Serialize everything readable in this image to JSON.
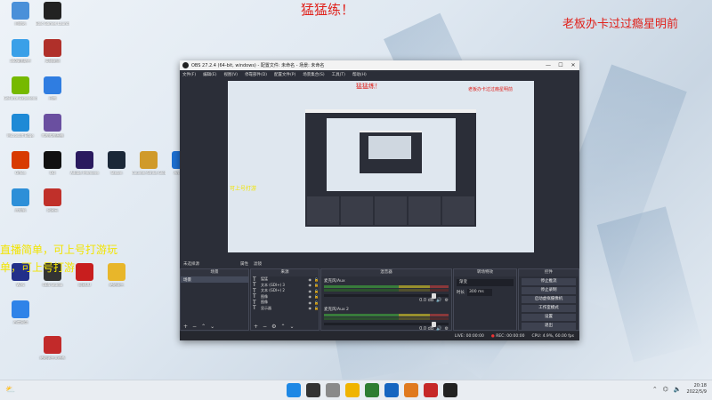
{
  "overlay": {
    "main": "猛猛练！",
    "right": "老板办卡过过瘾星明前",
    "left_line1": "直播简单，可上号打游玩",
    "left_line2": "单，可上号打游"
  },
  "desktop_icons": [
    {
      "label": "回收站",
      "color": "#4a90d9"
    },
    {
      "label": "Epic Games Launcher",
      "color": "#222222"
    },
    {
      "label": "360桌面助手",
      "color": "#3aa0e8"
    },
    {
      "label": "英雄联盟",
      "color": "#b0302a"
    },
    {
      "label": "GeForce Experience",
      "color": "#76b900"
    },
    {
      "label": "迅雷",
      "color": "#2f7de1"
    },
    {
      "label": "Microsoft Edge",
      "color": "#1e8ad6"
    },
    {
      "label": "哔哩哔哩直播",
      "color": "#6a4fa0"
    },
    {
      "label": "Office",
      "color": "#d83b01"
    },
    {
      "label": "QQ",
      "color": "#111111"
    },
    {
      "label": "Adobe Premiere",
      "color": "#2a1a5e"
    },
    {
      "label": "Steam",
      "color": "#1b2838"
    },
    {
      "label": "Counter-Strike Global Off...",
      "color": "#d09a2a"
    },
    {
      "label": "Arc Lab",
      "color": "#1c6fd1"
    },
    {
      "label": "此电脑",
      "color": "#2d8fd8"
    },
    {
      "label": "网易云",
      "color": "#c0302a"
    },
    {
      "label": "WPS",
      "color": "#222f8a"
    },
    {
      "label": "OBS Studio",
      "color": "#333333"
    },
    {
      "label": "网易UU",
      "color": "#c81e1e"
    },
    {
      "label": "绝地求生",
      "color": "#e8b62a"
    },
    {
      "label": "百度网盘",
      "color": "#2f83e8"
    },
    {
      "label": "绝地求生大逃杀",
      "color": "#c22a2a"
    }
  ],
  "obs": {
    "title": "OBS 27.2.4 (64-bit, windows) - 配置文件: 未命名 - 场景: 未命名",
    "menu": [
      "文件(F)",
      "编辑(E)",
      "视图(V)",
      "停靠部件(D)",
      "配置文件(P)",
      "场景集合(S)",
      "工具(T)",
      "帮助(H)"
    ],
    "preview_text1": "猛猛练！",
    "preview_text2": "老板办卡过过瘾星明前",
    "preview_text3": "可上号打游",
    "scene_bar": "未选择源",
    "scene_bar_btns": [
      "属性",
      "滤镜"
    ],
    "docks": {
      "scenes": "场景",
      "sources": "来源",
      "mixer": "混音器",
      "transitions": "转场特效",
      "controls": "控件"
    },
    "scene_items": [
      "场景"
    ],
    "sources": [
      {
        "name": "猛猛"
      },
      {
        "name": "文本 (GDI+) 3"
      },
      {
        "name": "文本 (GDI+) 2"
      },
      {
        "name": "图像"
      },
      {
        "name": "图像"
      },
      {
        "name": "显示器"
      }
    ],
    "mixer": [
      {
        "name": "麦克风/Aux",
        "db": "0.0 dB"
      },
      {
        "name": "麦克风/Aux 2",
        "db": "0.0 dB"
      },
      {
        "name": "桌面音频",
        "db": ""
      }
    ],
    "transition_type": "渐变",
    "duration_label": "时长",
    "duration_value": "300 ms",
    "controls": [
      "停止推流",
      "停止录制",
      "启动虚拟摄像机",
      "工作室模式",
      "设置",
      "退出"
    ],
    "status": {
      "live_label": "LIVE:",
      "live_time": "00:00:00",
      "rec_label": "REC:",
      "rec_time": "00:00:00",
      "cpu": "CPU: 4.9%, 60.00 fps"
    }
  },
  "taskbar": {
    "apps": [
      "#1e88e5",
      "#333333",
      "#8a8a8a",
      "#f0b400",
      "#2e7d32",
      "#1565c0",
      "#e07a1f",
      "#c62828",
      "#222222"
    ],
    "time": "20:18",
    "date": "2022/5/9"
  }
}
